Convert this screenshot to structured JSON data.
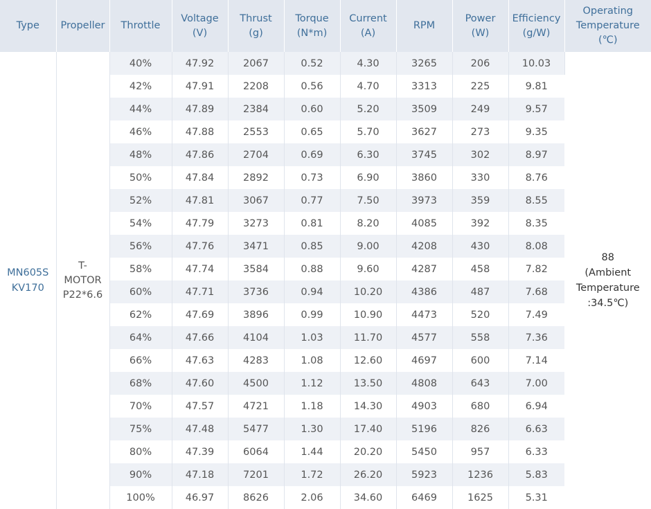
{
  "headers": {
    "type": "Type",
    "propeller": "Propeller",
    "throttle": "Throttle",
    "voltage": [
      "Voltage",
      "(V)"
    ],
    "thrust": [
      "Thrust",
      "(g)"
    ],
    "torque": [
      "Torque",
      "(N*m)"
    ],
    "current": [
      "Current",
      "(A)"
    ],
    "rpm": "RPM",
    "power": [
      "Power",
      "(W)"
    ],
    "efficiency": [
      "Efficiency",
      "(g/W)"
    ],
    "operating_temperature": [
      "Operating",
      "Temperature",
      "(℃)"
    ]
  },
  "type_value": [
    "MN605S",
    "KV170"
  ],
  "propeller_value": [
    "T-",
    "MOTOR",
    "P22*6.6"
  ],
  "temperature_value": [
    "88",
    "(Ambient",
    "Temperature",
    ":34.5℃)"
  ],
  "rows": [
    [
      "40%",
      "47.92",
      "2067",
      "0.52",
      "4.30",
      "3265",
      "206",
      "10.03"
    ],
    [
      "42%",
      "47.91",
      "2208",
      "0.56",
      "4.70",
      "3313",
      "225",
      "9.81"
    ],
    [
      "44%",
      "47.89",
      "2384",
      "0.60",
      "5.20",
      "3509",
      "249",
      "9.57"
    ],
    [
      "46%",
      "47.88",
      "2553",
      "0.65",
      "5.70",
      "3627",
      "273",
      "9.35"
    ],
    [
      "48%",
      "47.86",
      "2704",
      "0.69",
      "6.30",
      "3745",
      "302",
      "8.97"
    ],
    [
      "50%",
      "47.84",
      "2892",
      "0.73",
      "6.90",
      "3860",
      "330",
      "8.76"
    ],
    [
      "52%",
      "47.81",
      "3067",
      "0.77",
      "7.50",
      "3973",
      "359",
      "8.55"
    ],
    [
      "54%",
      "47.79",
      "3273",
      "0.81",
      "8.20",
      "4085",
      "392",
      "8.35"
    ],
    [
      "56%",
      "47.76",
      "3471",
      "0.85",
      "9.00",
      "4208",
      "430",
      "8.08"
    ],
    [
      "58%",
      "47.74",
      "3584",
      "0.88",
      "9.60",
      "4287",
      "458",
      "7.82"
    ],
    [
      "60%",
      "47.71",
      "3736",
      "0.94",
      "10.20",
      "4386",
      "487",
      "7.68"
    ],
    [
      "62%",
      "47.69",
      "3896",
      "0.99",
      "10.90",
      "4473",
      "520",
      "7.49"
    ],
    [
      "64%",
      "47.66",
      "4104",
      "1.03",
      "11.70",
      "4577",
      "558",
      "7.36"
    ],
    [
      "66%",
      "47.63",
      "4283",
      "1.08",
      "12.60",
      "4697",
      "600",
      "7.14"
    ],
    [
      "68%",
      "47.60",
      "4500",
      "1.12",
      "13.50",
      "4808",
      "643",
      "7.00"
    ],
    [
      "70%",
      "47.57",
      "4721",
      "1.18",
      "14.30",
      "4903",
      "680",
      "6.94"
    ],
    [
      "75%",
      "47.48",
      "5477",
      "1.30",
      "17.40",
      "5196",
      "826",
      "6.63"
    ],
    [
      "80%",
      "47.39",
      "6064",
      "1.44",
      "20.20",
      "5450",
      "957",
      "6.33"
    ],
    [
      "90%",
      "47.18",
      "7201",
      "1.72",
      "26.20",
      "5923",
      "1236",
      "5.83"
    ],
    [
      "100%",
      "46.97",
      "8626",
      "2.06",
      "34.60",
      "6469",
      "1625",
      "5.31"
    ]
  ]
}
